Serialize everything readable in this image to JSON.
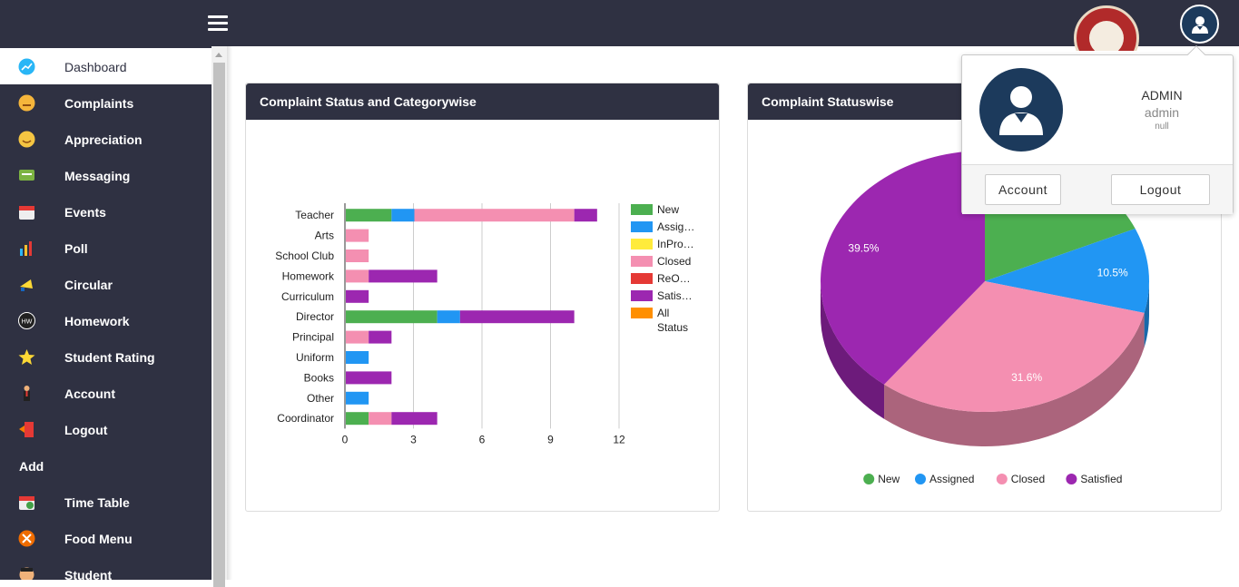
{
  "sidebar": {
    "items": [
      {
        "label": "Dashboard",
        "icon": "chart-line-icon"
      },
      {
        "label": "Complaints",
        "icon": "angry-face-icon"
      },
      {
        "label": "Appreciation",
        "icon": "smiley-face-icon"
      },
      {
        "label": "Messaging",
        "icon": "chat-bubble-icon"
      },
      {
        "label": "Events",
        "icon": "calendar-icon"
      },
      {
        "label": "Poll",
        "icon": "bar-chart-icon"
      },
      {
        "label": "Circular",
        "icon": "megaphone-icon"
      },
      {
        "label": "Homework",
        "icon": "homework-icon"
      },
      {
        "label": "Student Rating",
        "icon": "star-icon"
      },
      {
        "label": "Account",
        "icon": "person-icon"
      },
      {
        "label": "Logout",
        "icon": "door-exit-icon"
      }
    ],
    "section_header": "Add",
    "add_items": [
      {
        "label": "Time Table",
        "icon": "calendar-clock-icon"
      },
      {
        "label": "Food Menu",
        "icon": "fork-knife-icon"
      },
      {
        "label": "Student",
        "icon": "student-icon"
      }
    ]
  },
  "cards": {
    "bar_title": "Complaint Status and Categorywise",
    "pie_title": "Complaint Statuswise"
  },
  "popup": {
    "name": "ADMIN",
    "username": "admin",
    "extra": "null",
    "account_label": "Account",
    "logout_label": "Logout"
  },
  "colors": {
    "New": "#4caf50",
    "Assigned": "#2196f3",
    "InProgress": "#ffeb3b",
    "Closed": "#f48fb1",
    "ReOpened": "#e53935",
    "Satisfied": "#9c27b0",
    "AllStatus": "#ff8f00",
    "header": "#2f3142"
  },
  "chart_data": [
    {
      "type": "bar",
      "orientation": "horizontal",
      "stacked": true,
      "categories": [
        "Teacher",
        "Arts",
        "School Club",
        "Homework",
        "Curriculum",
        "Director",
        "Principal",
        "Uniform",
        "Books",
        "Other",
        "Coordinator"
      ],
      "series": [
        {
          "name": "New",
          "values": [
            2,
            0,
            0,
            0,
            0,
            4,
            0,
            0,
            0,
            0,
            1
          ]
        },
        {
          "name": "Assig…",
          "values": [
            1,
            0,
            0,
            0,
            0,
            1,
            0,
            1,
            0,
            1,
            0
          ]
        },
        {
          "name": "InPro…",
          "values": [
            0,
            0,
            0,
            0,
            0,
            0,
            0,
            0,
            0,
            0,
            0
          ]
        },
        {
          "name": "Closed",
          "values": [
            7,
            1,
            1,
            1,
            0,
            0,
            1,
            0,
            0,
            0,
            1
          ]
        },
        {
          "name": "ReO…",
          "values": [
            0,
            0,
            0,
            0,
            0,
            0,
            0,
            0,
            0,
            0,
            0
          ]
        },
        {
          "name": "Satis…",
          "values": [
            1,
            0,
            0,
            3,
            1,
            5,
            1,
            0,
            2,
            0,
            2
          ]
        },
        {
          "name": "All Status",
          "values": [
            0,
            0,
            0,
            0,
            0,
            0,
            0,
            0,
            0,
            0,
            0
          ]
        }
      ],
      "xticks": [
        "0",
        "3",
        "6",
        "9",
        "12"
      ],
      "xlim": [
        0,
        12
      ],
      "legend": "right"
    },
    {
      "type": "pie",
      "is3d": true,
      "labels": [
        "New",
        "Assigned",
        "Closed",
        "Satisfied"
      ],
      "values": [
        18.4,
        10.5,
        31.6,
        39.5
      ],
      "value_labels": [
        "",
        "10.5%",
        "31.6%",
        "39.5%"
      ],
      "legend": "bottom"
    }
  ]
}
